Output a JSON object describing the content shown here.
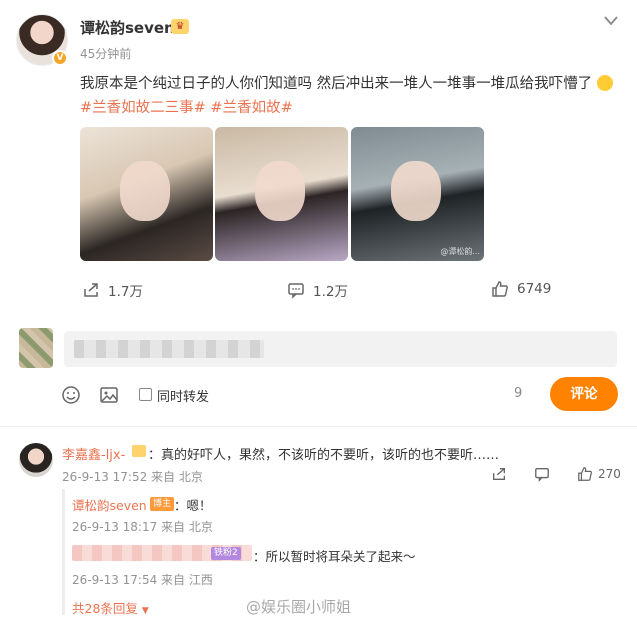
{
  "post": {
    "author": "谭松韵seven",
    "time": "45分钟前",
    "text": "我原本是个纯过日子的人你们知道吗 然后冲出来一堆人一堆事一堆瓜给我吓懵了",
    "tags": [
      "#兰香如故二三事#",
      "#兰香如故#"
    ],
    "images": [
      "photo-1",
      "photo-2",
      "photo-3"
    ],
    "photo3_watermark": "@谭松韵..."
  },
  "actions": {
    "forward": "1.7万",
    "comment": "1.2万",
    "like": "6749"
  },
  "composer": {
    "forward_label": "同时转发",
    "count": "9",
    "submit_label": "评论"
  },
  "comment": {
    "name": "李嘉鑫-ljx-",
    "text": "：真的好吓人，果然，不该听的不要听，该听的也不要听……",
    "meta": "26-9-13 17:52 来自 北京",
    "likes": "270",
    "replies": [
      {
        "name": "谭松韵seven",
        "badge": "博主",
        "text": "：嗯！",
        "meta": "26-9-13 18:17 来自 北京"
      },
      {
        "badge": "铁粉2",
        "text": "：所以暂时将耳朵关了起来～",
        "meta": "26-9-13 17:54 来自 江西"
      }
    ],
    "more_replies": "共28条回复"
  },
  "watermark": "@娱乐圈小师姐",
  "colors": {
    "accent": "#ff8200",
    "link": "#eb7350"
  }
}
